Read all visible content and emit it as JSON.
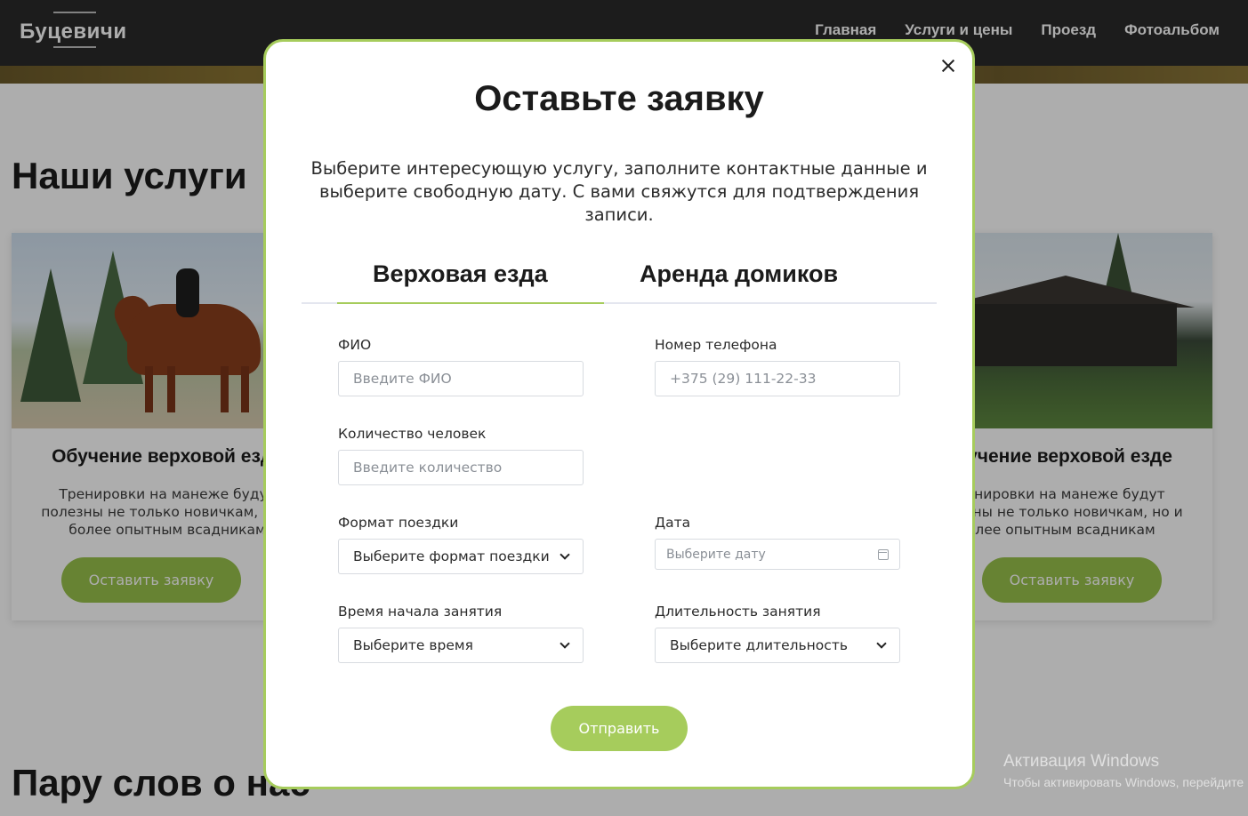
{
  "site": {
    "logo": "Буцевичи",
    "nav": [
      "Главная",
      "Услуги и цены",
      "Проезд",
      "Фотоальбом"
    ]
  },
  "services": {
    "title": "Наши услуги",
    "cards": [
      {
        "title": "Обучение верховой езде",
        "description": "Тренировки на манеже будут полезны не только новичкам, но и более опытным всадникам",
        "button": "Оставить заявку"
      },
      {
        "title": "Обучение верховой езде",
        "description": "Тренировки на манеже будут полезны не только новичкам, но и более опытным всадникам",
        "button": "Оставить заявку"
      }
    ]
  },
  "about": {
    "title": "Пару слов о нас"
  },
  "modal": {
    "title": "Оставьте заявку",
    "description": "Выберите интересующую услугу, заполните контактные данные и выберите свободную дату. С вами свяжутся для подтверждения записи.",
    "tabs": [
      "Верховая езда",
      "Аренда домиков"
    ],
    "active_tab": "Верховая езда",
    "fields": {
      "name": {
        "label": "ФИО",
        "placeholder": "Введите ФИО"
      },
      "phone": {
        "label": "Номер телефона",
        "placeholder": "+375 (29) 111-22-33"
      },
      "people": {
        "label": "Количество человек",
        "placeholder": "Введите количество"
      },
      "format": {
        "label": "Формат поездки",
        "value": "Выберите формат поездки"
      },
      "date": {
        "label": "Дата",
        "placeholder": "Выберите дату"
      },
      "start_time": {
        "label": "Время начала занятия",
        "value": "Выберите время"
      },
      "duration": {
        "label": "Длительность занятия",
        "value": "Выберите длительность"
      }
    },
    "submit": "Отправить"
  },
  "windows_activation": {
    "line1": "Активация Windows",
    "line2": "Чтобы активировать Windows, перейдите"
  },
  "colors": {
    "accent": "#a6cc5c",
    "header_bg": "#2a2a2a",
    "text": "#1b1b1b"
  }
}
